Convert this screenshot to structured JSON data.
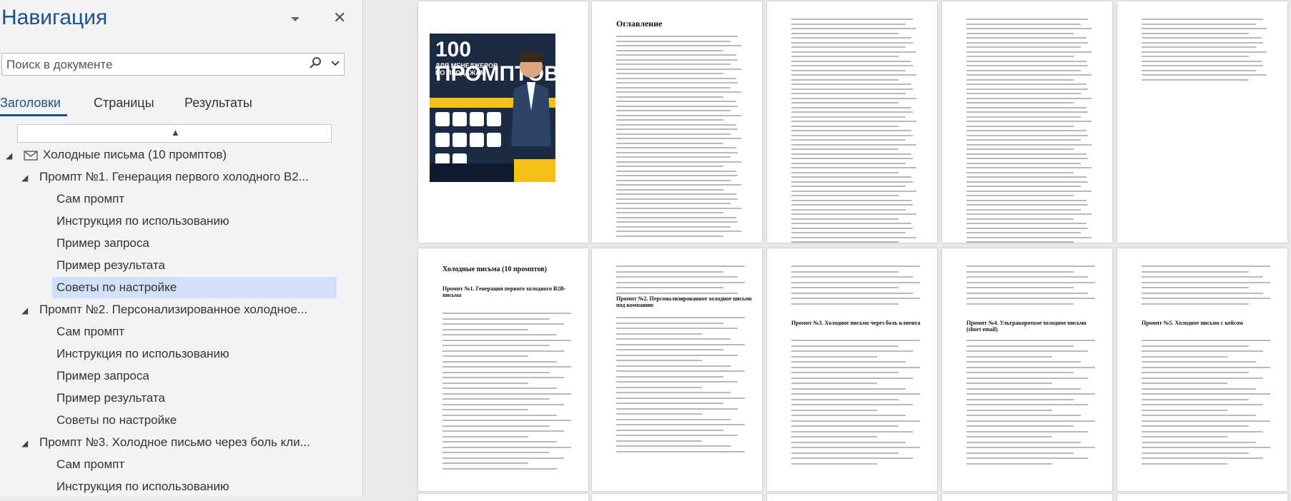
{
  "nav": {
    "title": "Навигация",
    "search_placeholder": "Поиск в документе",
    "tabs": [
      "Заголовки",
      "Страницы",
      "Результаты"
    ],
    "headings": [
      {
        "text": "Холодные письма (10 промптов)",
        "level": 1
      },
      {
        "text": "Промпт №1. Генерация первого холодного B2...",
        "level": 2
      },
      {
        "text": "Сам промпт",
        "level": 3
      },
      {
        "text": "Инструкция по использованию",
        "level": 3
      },
      {
        "text": "Пример запроса",
        "level": 3
      },
      {
        "text": "Пример результата",
        "level": 3
      },
      {
        "text": "Советы по настройке",
        "level": 3,
        "selected": true
      },
      {
        "text": "Промпт №2. Персонализированное холодное...",
        "level": 2
      },
      {
        "text": "Сам промпт",
        "level": 3
      },
      {
        "text": "Инструкция по использованию",
        "level": 3
      },
      {
        "text": "Пример запроса",
        "level": 3
      },
      {
        "text": "Пример результата",
        "level": 3
      },
      {
        "text": "Советы по настройке",
        "level": 3
      },
      {
        "text": "Промпт №3. Холодное письмо через боль кли...",
        "level": 2
      },
      {
        "text": "Сам промпт",
        "level": 3
      },
      {
        "text": "Инструкция по использованию",
        "level": 3
      }
    ]
  },
  "pages": {
    "toc_title": "Оглавление",
    "cover_big": "100 ПРОМПТОВ",
    "cover_sub": "ДЛЯ МЕНЕДЖЕРОВ ПО ПРОДАЖАМ",
    "cold_title": "Холодные письма (10 промптов)",
    "p1_title": "Промпт №1. Генерация первого холодного B2B-письма",
    "p2_title": "Промпт №2. Персонализированное холодное письмо под компанию",
    "p3_title": "Промпт №3. Холодное письмо через боль клиента",
    "p4_title": "Промпт №4. Ультракороткое холодное письмо (short email)",
    "p5_title": "Промпт №5. Холодное письмо с кейсом"
  },
  "colors": {
    "accent": "#1e4e8c",
    "selected": "#cfe0f8",
    "cover_bg": "#1b2b44",
    "cover_yellow": "#f4c017"
  }
}
